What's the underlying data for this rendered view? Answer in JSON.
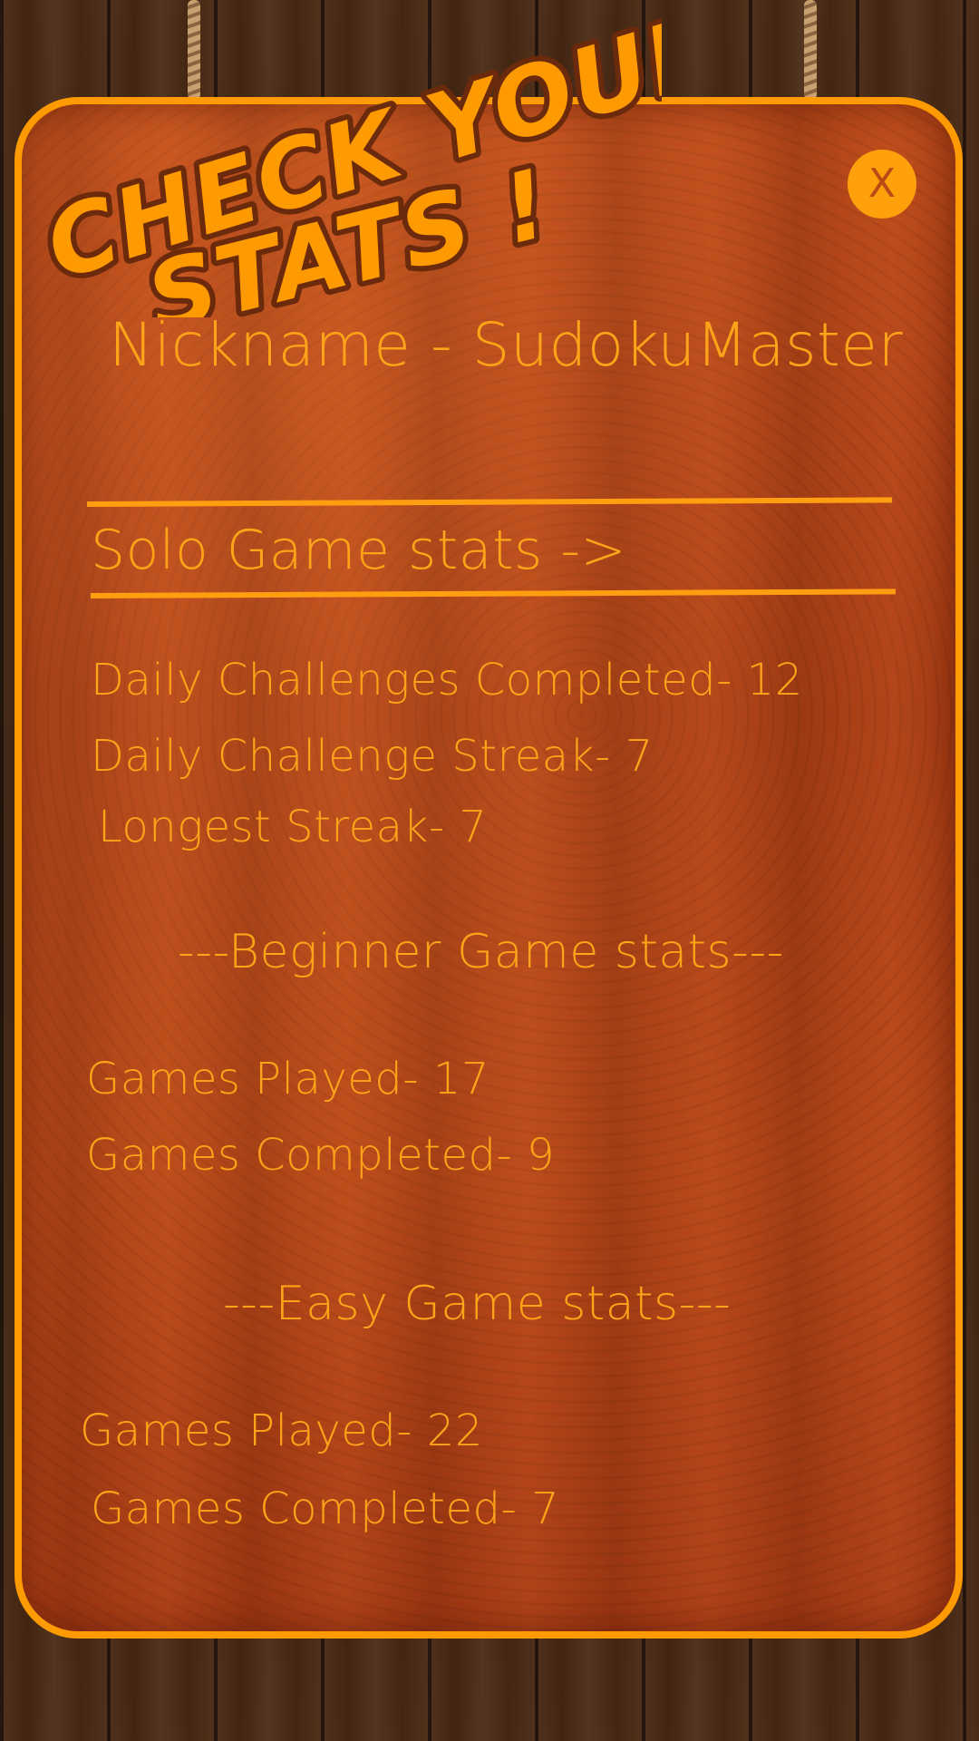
{
  "headline": {
    "line1": "CHECK YOUR",
    "line2": "STATS !"
  },
  "close_button": {
    "label": "X"
  },
  "nickname": "Nickname - SudokuMaster",
  "solo": {
    "title": "Solo Game stats ->",
    "daily_completed": "Daily Challenges Completed- 12",
    "daily_streak": "Daily Challenge Streak- 7",
    "longest_streak": "Longest Streak- 7"
  },
  "beginner": {
    "title": "---Beginner Game stats---",
    "played": "Games Played- 17",
    "completed": "Games Completed- 9"
  },
  "easy": {
    "title": "---Easy Game stats---",
    "played": "Games Played- 22",
    "completed": "Games Completed- 7"
  },
  "colors": {
    "accent": "#ff9a00",
    "text": "#ffa319",
    "board": "#b0441a",
    "headline_outline": "#6b2a0c"
  }
}
